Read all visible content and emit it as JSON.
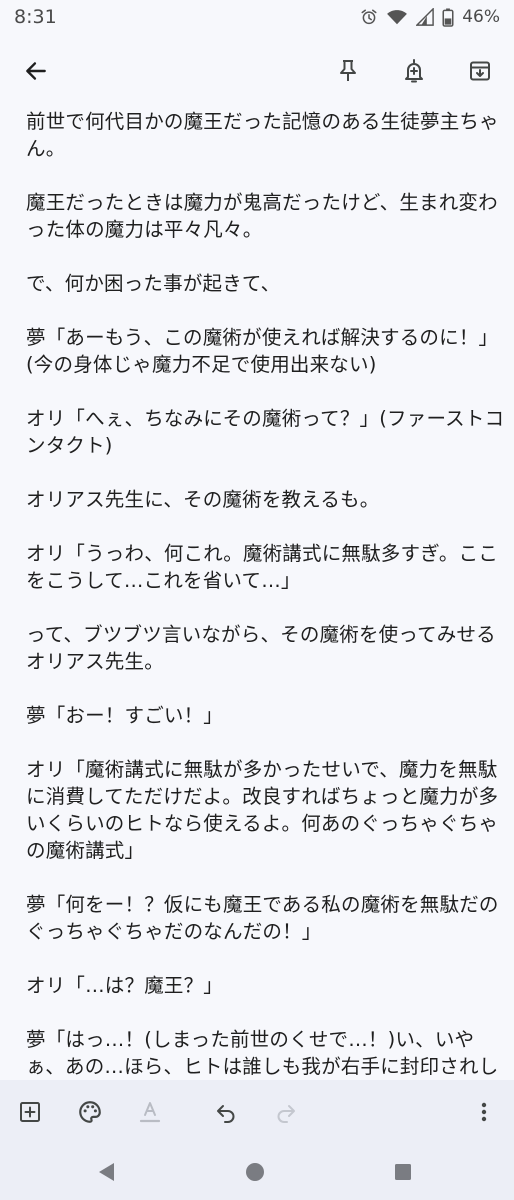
{
  "status_bar": {
    "time": "8:31",
    "battery": "46%",
    "icons": [
      "alarm-icon",
      "wifi-icon",
      "signal-icon",
      "battery-icon"
    ]
  },
  "app_bar": {
    "icons": [
      "back-arrow-icon",
      "pin-icon",
      "reminder-bell-icon",
      "archive-icon"
    ]
  },
  "note": {
    "paragraphs": [
      "前世で何代目かの魔王だった記憶のある生徒夢主ちゃん。",
      "魔王だったときは魔力が鬼高だったけど、生まれ変わった体の魔力は平々凡々。",
      "で、何か困った事が起きて、",
      "夢「あーもう、この魔術が使えれば解決するのに！」(今の身体じゃ魔力不足で使用出来ない)",
      "オリ「へぇ、ちなみにその魔術って？」(ファーストコンタクト)",
      "オリアス先生に、その魔術を教えるも。",
      "オリ「うっわ、何これ。魔術講式に無駄多すぎ。ここをこうして…これを省いて…」",
      "って、ブツブツ言いながら、その魔術を使ってみせるオリアス先生。",
      "夢「おー！すごい！」",
      "オリ「魔術講式に無駄が多かったせいで、魔力を無駄に消費してただけだよ。改良すればちょっと魔力が多いくらいのヒトなら使えるよ。何あのぐっちゃぐちゃの魔術講式」",
      "夢「何をー！？仮にも魔王である私の魔術を無駄だのぐっちゃぐちゃだのなんだの！」",
      "オリ「…は？魔王？」",
      "夢「はっ…！(しまった前世のくせで…！)い、いやぁ、あの…ほら、ヒトは誰しも我が右手に封印されし力が…！って時期が訪れるじゃないですか〜。その延長線というか…」"
    ]
  },
  "bottom_toolbar": {
    "icons": [
      "add-box-icon",
      "palette-icon",
      "text-format-icon",
      "undo-icon",
      "redo-icon",
      "more-vert-icon"
    ]
  },
  "nav_bar": {
    "icons": [
      "nav-back-icon",
      "nav-home-icon",
      "nav-recents-icon"
    ]
  },
  "colors": {
    "background": "#f7f8fc",
    "toolbar_background": "#eceef6",
    "text": "#1f1f1f",
    "icon": "#444746",
    "disabled_icon": "#b9bcc4"
  }
}
